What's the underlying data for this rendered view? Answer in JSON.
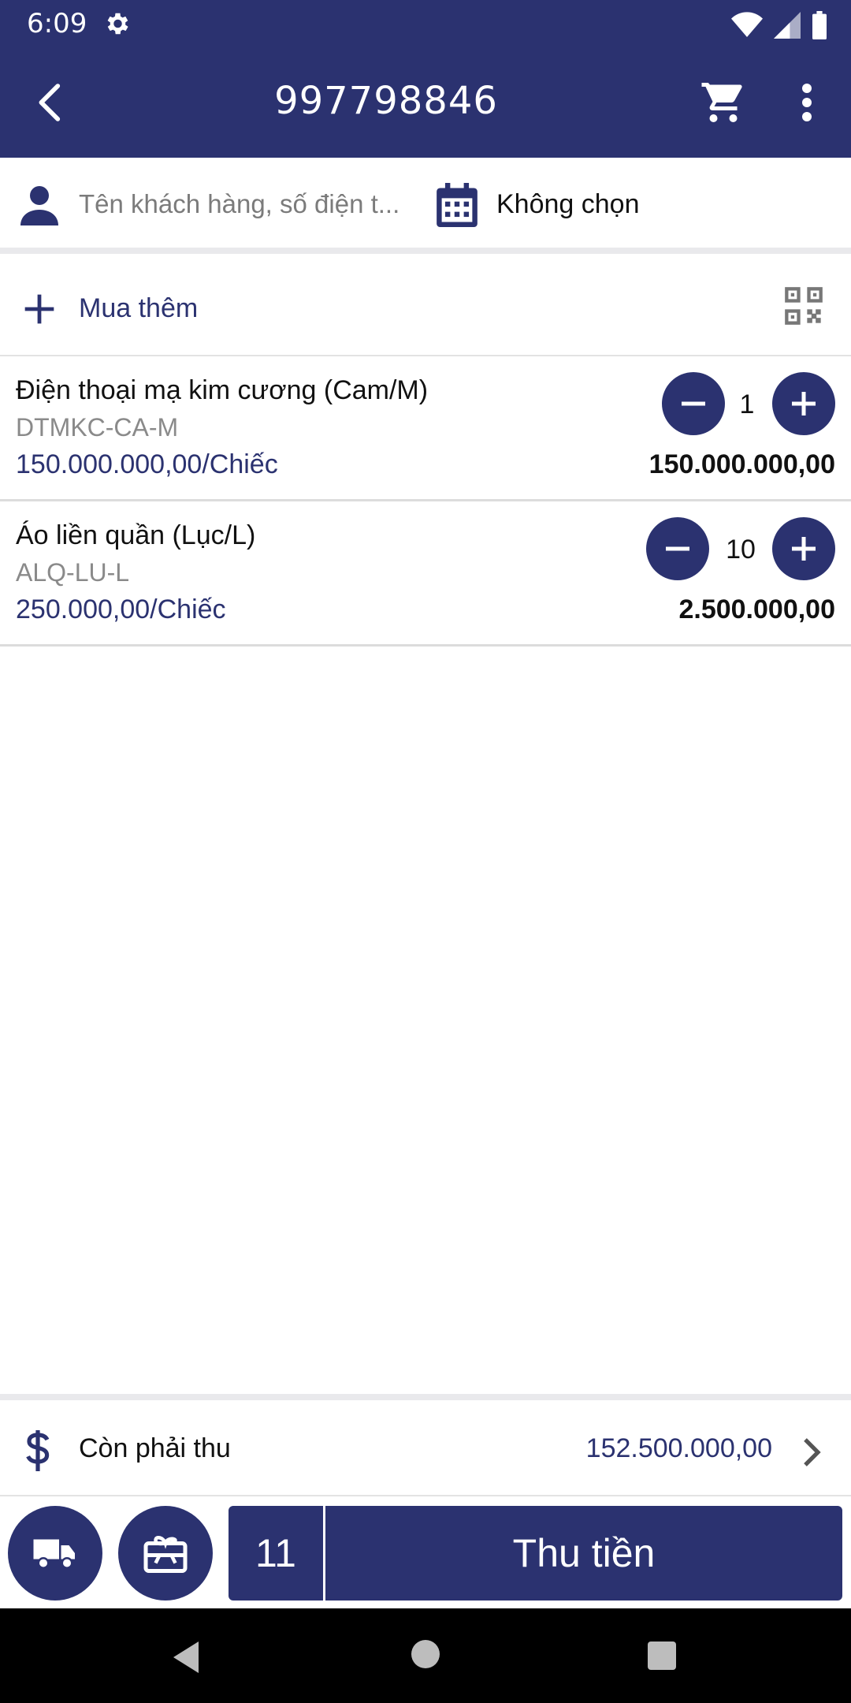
{
  "status_bar": {
    "time": "6:09",
    "icons": [
      "gear-icon",
      "wifi-icon",
      "signal-icon",
      "battery-icon"
    ]
  },
  "app_bar": {
    "title": "997798846",
    "icons": [
      "back-arrow-icon",
      "cart-icon",
      "more-vertical-icon"
    ]
  },
  "customer": {
    "placeholder": "Tên khách hàng, số điện t...",
    "date_label": "Không chọn"
  },
  "add_more": {
    "label": "Mua thêm"
  },
  "items": [
    {
      "name": "Điện thoại mạ kim cương (Cam/M)",
      "sku": "DTMKC-CA-M",
      "unit_price": "150.000.000,00/Chiếc",
      "qty": "1",
      "total": "150.000.000,00"
    },
    {
      "name": "Áo liền quần (Lục/L)",
      "sku": "ALQ-LU-L",
      "unit_price": "250.000,00/Chiếc",
      "qty": "10",
      "total": "2.500.000,00"
    }
  ],
  "due": {
    "label": "Còn phải thu",
    "value": "152.500.000,00"
  },
  "bottom": {
    "count": "11",
    "pay_label": "Thu tiền"
  },
  "colors": {
    "primary": "#2b3270",
    "divider": "#e9e9ec",
    "muted_text": "#8a8a8a"
  }
}
